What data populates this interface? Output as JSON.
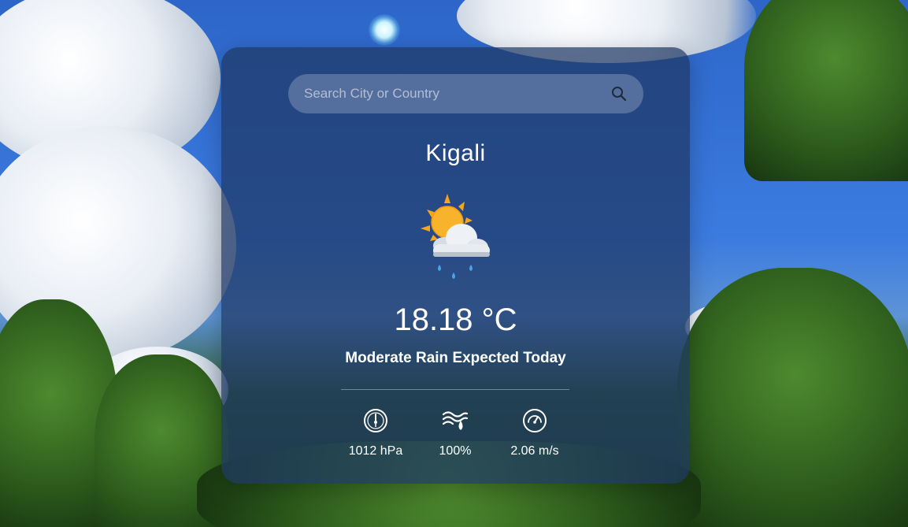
{
  "search": {
    "placeholder": "Search City or Country",
    "value": "",
    "button_icon": "search-icon"
  },
  "weather": {
    "city": "Kigali",
    "icon": "sun-behind-rain-cloud-icon",
    "temperature": "18.18 °C",
    "description": "Moderate Rain Expected Today"
  },
  "stats": [
    {
      "name": "pressure",
      "icon": "pressure-gauge-icon",
      "value": "1012 hPa"
    },
    {
      "name": "humidity",
      "icon": "humidity-icon",
      "value": "100%"
    },
    {
      "name": "wind-speed",
      "icon": "wind-speed-icon",
      "value": "2.06 m/s"
    }
  ],
  "colors": {
    "card": "#1e3764",
    "text": "#ffffff",
    "sun": "#f7b32b",
    "rain": "#4aa3e8"
  }
}
